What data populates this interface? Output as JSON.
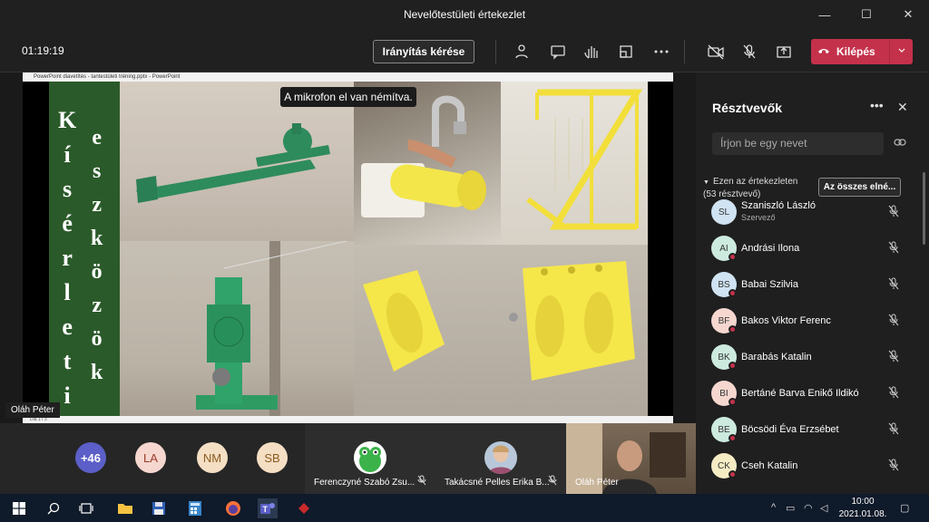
{
  "window": {
    "title": "Nevelőtestületi értekezlet",
    "minimize_icon": "—",
    "maximize_icon": "☐",
    "close_icon": "✕"
  },
  "toolbar": {
    "timer": "01:19:19",
    "control_button": "Irányítás kérése",
    "leave_button": "Kilépés",
    "leave_color": "#c4314b",
    "icons": [
      "participants-icon",
      "chat-icon",
      "raise-hand-icon",
      "rooms-icon",
      "more-icon",
      "camera-off-icon",
      "mic-off-icon",
      "share-icon"
    ]
  },
  "share": {
    "powerpoint_title": "PowerPoint diavetítés - tantestületi tréning.pptx - PowerPoint",
    "status_left": "Dia 1 / 3",
    "mute_notice": "A mikrofon el van némítva.",
    "presenter_label": "Oláh Péter",
    "slide": {
      "band_color": "#2b5a2a",
      "word1_letters": [
        "K",
        "í",
        "s",
        "é",
        "r",
        "l",
        "e",
        "t",
        "i"
      ],
      "word2_letters": [
        "e",
        "s",
        "z",
        "k",
        "ö",
        "z",
        "ö",
        "k"
      ]
    }
  },
  "strip": {
    "overflow": "+46",
    "avatars": [
      {
        "initials": "LA",
        "color": "#f6d7cf"
      },
      {
        "initials": "NM",
        "color": "#f5dfc4"
      },
      {
        "initials": "SB",
        "color": "#f5dfc4"
      }
    ],
    "overflow_color": "#5b5fc7",
    "tiles": [
      {
        "name": "Ferenczyné Szabó Zsu...",
        "mic": "🎙"
      },
      {
        "name": "Takácsné Pelles Erika B...",
        "mic": "🎙"
      },
      {
        "name": "Oláh Péter",
        "mic": ""
      }
    ]
  },
  "panel": {
    "title": "Résztvevők",
    "search_placeholder": "Írjon be egy nevet",
    "section_label": "Ezen az értekezleten (53 résztvevő)",
    "admit_all": "Az összes elné...",
    "participants": [
      {
        "initials": "SL",
        "name": "Szaniszló László",
        "role": "Szervező",
        "color": "#cfe3f2"
      },
      {
        "initials": "AI",
        "name": "Andrási Ilona",
        "role": "",
        "color": "#cdeadf"
      },
      {
        "initials": "BS",
        "name": "Babai Szilvia",
        "role": "",
        "color": "#cfe3f2"
      },
      {
        "initials": "BF",
        "name": "Bakos Viktor Ferenc",
        "role": "",
        "color": "#f6d7cf"
      },
      {
        "initials": "BK",
        "name": "Barabás Katalin",
        "role": "",
        "color": "#cdeadf"
      },
      {
        "initials": "BI",
        "name": "Bertáné Barva Enikő Ildikó",
        "role": "",
        "color": "#f6d7cf"
      },
      {
        "initials": "BE",
        "name": "Böcsödi Éva Erzsébet",
        "role": "",
        "color": "#cdeadf"
      },
      {
        "initials": "CK",
        "name": "Cseh Katalin",
        "role": "",
        "color": "#f5ecc4"
      }
    ]
  },
  "taskbar": {
    "time": "10:00",
    "date": "2021.01.08.",
    "apps": [
      "windows-start-icon",
      "search-icon",
      "task-view-icon",
      "file-explorer-icon",
      "save-disk-icon",
      "calculator-icon",
      "firefox-icon",
      "teams-icon",
      "app-icon"
    ]
  }
}
